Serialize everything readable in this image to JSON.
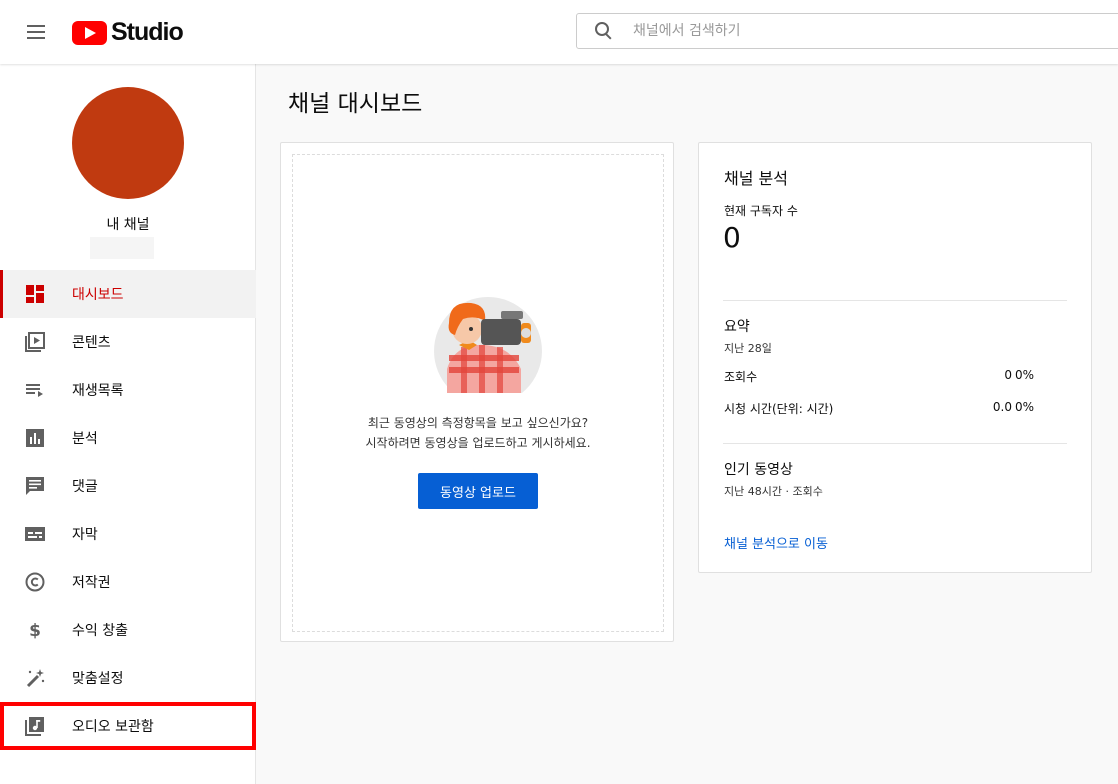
{
  "header": {
    "logo_text": "Studio",
    "search_placeholder": "채널에서 검색하기"
  },
  "sidebar": {
    "channel_label": "내 채널",
    "items": [
      {
        "label": "대시보드",
        "icon": "dashboard-icon",
        "active": true
      },
      {
        "label": "콘텐츠",
        "icon": "content-icon"
      },
      {
        "label": "재생목록",
        "icon": "playlist-icon"
      },
      {
        "label": "분석",
        "icon": "analytics-icon"
      },
      {
        "label": "댓글",
        "icon": "comments-icon"
      },
      {
        "label": "자막",
        "icon": "subtitles-icon"
      },
      {
        "label": "저작권",
        "icon": "copyright-icon"
      },
      {
        "label": "수익 창출",
        "icon": "dollar-icon"
      },
      {
        "label": "맞춤설정",
        "icon": "magic-wand-icon"
      },
      {
        "label": "오디오 보관함",
        "icon": "audio-library-icon",
        "highlighted": true
      }
    ]
  },
  "main": {
    "title": "채널 대시보드",
    "upload_card": {
      "line1": "최근 동영상의 측정항목을 보고 싶으신가요?",
      "line2": "시작하려면 동영상을 업로드하고 게시하세요.",
      "button_label": "동영상 업로드"
    },
    "analytics": {
      "title": "채널 분석",
      "subscribers_label": "현재 구독자 수",
      "subscribers_value": "0",
      "summary_title": "요약",
      "summary_period": "지난 28일",
      "metrics": [
        {
          "name": "조회수",
          "value": "0",
          "pct": "0%"
        },
        {
          "name": "시청 시간(단위: 시간)",
          "value": "0.0",
          "pct": "0%"
        }
      ],
      "top_videos_title": "인기 동영상",
      "top_videos_sub": "지난 48시간 · 조회수",
      "link_label": "채널 분석으로 이동"
    }
  },
  "colors": {
    "accent_red": "#cc0000",
    "brand_red": "#ff0000",
    "link_blue": "#065fd4",
    "avatar": "#c03a10"
  }
}
